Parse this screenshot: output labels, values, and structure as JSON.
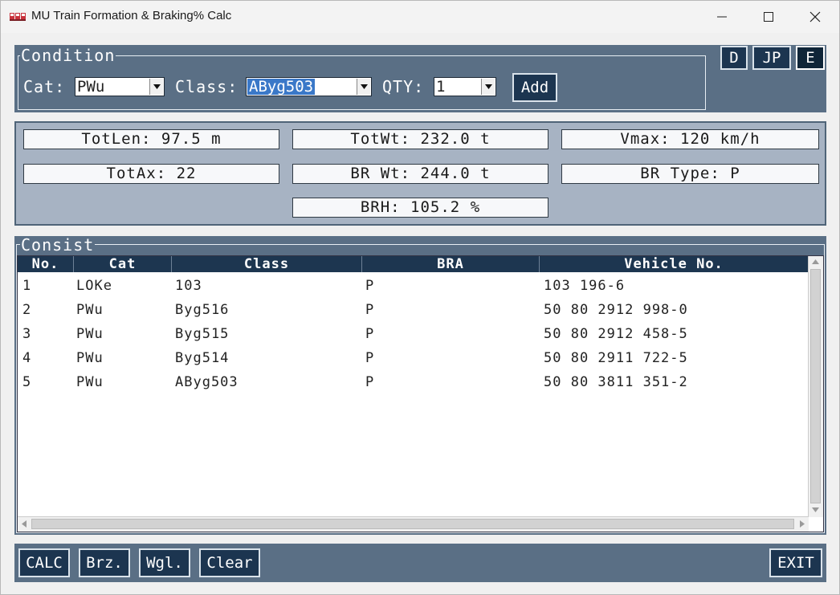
{
  "window": {
    "title": "MU Train Formation & Braking% Calc"
  },
  "condition": {
    "legend": "Condition",
    "cat_label": "Cat:",
    "cat_value": "PWu",
    "class_label": "Class:",
    "class_value": "AByg503",
    "qty_label": "QTY:",
    "qty_value": "1",
    "add_label": "Add"
  },
  "language": {
    "d": "D",
    "jp": "JP",
    "e": "E",
    "active": "E"
  },
  "stats": {
    "tot_len": "TotLen: 97.5 m",
    "tot_wt": "TotWt: 232.0 t",
    "vmax": "Vmax: 120 km/h",
    "tot_ax": "TotAx: 22",
    "br_wt": "BR Wt: 244.0 t",
    "br_type": "BR Type: P",
    "brh": "BRH: 105.2 %"
  },
  "consist": {
    "legend": "Consist",
    "columns": [
      "No.",
      "Cat",
      "Class",
      "BRA",
      "Vehicle No."
    ],
    "rows": [
      {
        "no": "1",
        "cat": "LOKe",
        "class": "103",
        "bra": "P",
        "vehicle": "103 196-6"
      },
      {
        "no": "2",
        "cat": "PWu",
        "class": "Byg516",
        "bra": "P",
        "vehicle": "50 80 2912 998-0"
      },
      {
        "no": "3",
        "cat": "PWu",
        "class": "Byg515",
        "bra": "P",
        "vehicle": "50 80 2912 458-5"
      },
      {
        "no": "4",
        "cat": "PWu",
        "class": "Byg514",
        "bra": "P",
        "vehicle": "50 80 2911 722-5"
      },
      {
        "no": "5",
        "cat": "PWu",
        "class": "AByg503",
        "bra": "P",
        "vehicle": "50 80 3811 351-2"
      }
    ]
  },
  "toolbar": {
    "calc": "CALC",
    "brz": "Brz.",
    "wgl": "Wgl.",
    "clear": "Clear",
    "exit": "EXIT"
  },
  "colors": {
    "panel": "#5a6f85",
    "button": "#1c3550",
    "stats_bg": "#a7b3c3"
  }
}
